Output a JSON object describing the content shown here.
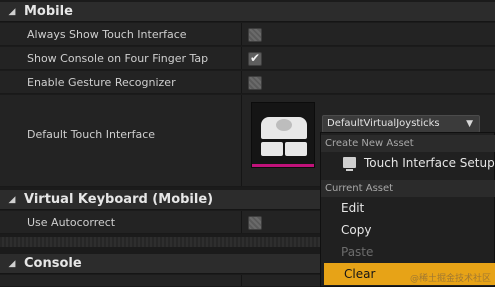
{
  "sections": {
    "mobile": {
      "title": "Mobile",
      "arrow": "◢"
    },
    "virtual_keyboard": {
      "title": "Virtual Keyboard (Mobile)",
      "arrow": "◢"
    },
    "console": {
      "title": "Console",
      "arrow": "◢"
    }
  },
  "rows": {
    "always_show_touch": {
      "label": "Always Show Touch Interface",
      "checked": false
    },
    "show_console_four_finger": {
      "label": "Show Console on Four Finger Tap",
      "checked": true
    },
    "enable_gesture": {
      "label": "Enable Gesture Recognizer",
      "checked": false
    },
    "default_touch": {
      "label": "Default Touch Interface"
    },
    "use_autocorrect": {
      "label": "Use Autocorrect",
      "checked": false
    }
  },
  "asset_picker": {
    "selected_value": "DefaultVirtualJoysticks",
    "caret": "▼"
  },
  "menu": {
    "create_new_asset_header": "Create New Asset",
    "touch_interface_setup": "Touch Interface Setup",
    "current_asset_header": "Current Asset",
    "edit": "Edit",
    "copy": "Copy",
    "paste": "Paste",
    "clear": "Clear"
  },
  "checkmark": "✔",
  "watermark": "@稀土掘金技术社区",
  "colors": {
    "accent": "#e7a317",
    "thumbnail_bar": "#c1127a",
    "panel_bg": "#232323",
    "header_bg": "#2c2c2c"
  }
}
